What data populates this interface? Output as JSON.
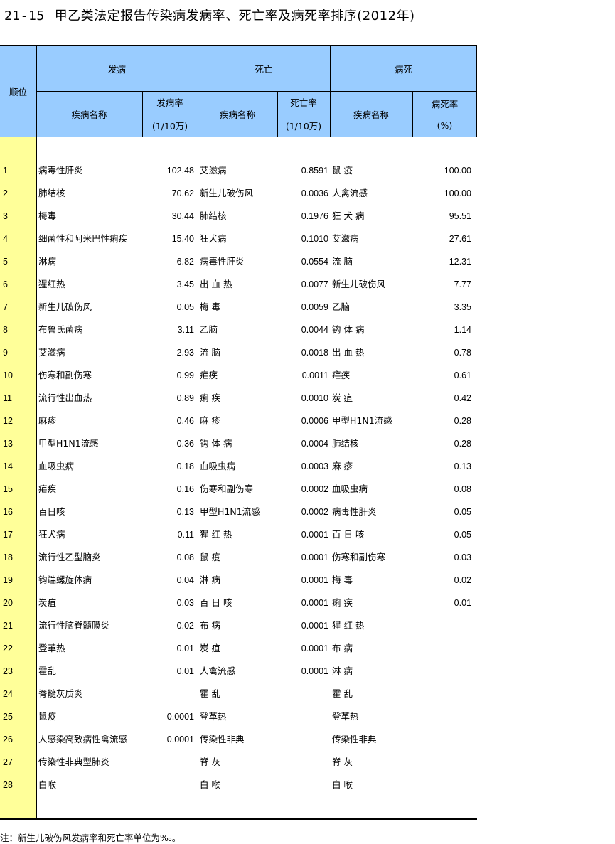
{
  "title": {
    "number": "21-15",
    "text": "甲乙类法定报告传染病发病率、死亡率及病死率排序(2012年)"
  },
  "header": {
    "rank": "顺位",
    "incidence": "发病",
    "death": "死亡",
    "fatality": "病死",
    "disease_name": "疾病名称",
    "incidence_rate_line1": "发病率",
    "incidence_rate_line2": "(1/10万)",
    "death_rate_line1": "死亡率",
    "death_rate_line2": "(1/10万)",
    "fatality_rate_line1": "病死率",
    "fatality_rate_line2": "(%)"
  },
  "rows": [
    {
      "rank": "1",
      "d1": "病毒性肝炎",
      "r1": "102.48",
      "d2": "艾滋病",
      "r2": "0.8591",
      "d3": "鼠 疫",
      "r3": "100.00"
    },
    {
      "rank": "2",
      "d1": "肺结核",
      "r1": "70.62",
      "d2": "新生儿破伤风",
      "r2": "0.0036",
      "d3": "人禽流感",
      "r3": "100.00"
    },
    {
      "rank": "3",
      "d1": "梅毒",
      "r1": "30.44",
      "d2": "肺结核",
      "r2": "0.1976",
      "d3": "狂 犬 病",
      "r3": "95.51"
    },
    {
      "rank": "4",
      "d1": "细菌性和阿米巴性痢疾",
      "r1": "15.40",
      "d2": "狂犬病",
      "r2": "0.1010",
      "d3": "艾滋病",
      "r3": "27.61"
    },
    {
      "rank": "5",
      "d1": "淋病",
      "r1": "6.82",
      "d2": "病毒性肝炎",
      "r2": "0.0554",
      "d3": "流 脑",
      "r3": "12.31"
    },
    {
      "rank": "6",
      "d1": "猩红热",
      "r1": "3.45",
      "d2": "出 血 热",
      "r2": "0.0077",
      "d3": "新生儿破伤风",
      "r3": "7.77"
    },
    {
      "rank": "7",
      "d1": "新生儿破伤风",
      "r1": "0.05",
      "d2": "梅 毒",
      "r2": "0.0059",
      "d3": "乙脑",
      "r3": "3.35"
    },
    {
      "rank": "8",
      "d1": "布鲁氏菌病",
      "r1": "3.11",
      "d2": "乙脑",
      "r2": "0.0044",
      "d3": "钩 体 病",
      "r3": "1.14"
    },
    {
      "rank": "9",
      "d1": "艾滋病",
      "r1": "2.93",
      "d2": "流 脑",
      "r2": "0.0018",
      "d3": "出 血 热",
      "r3": "0.78"
    },
    {
      "rank": "10",
      "d1": "伤寒和副伤寒",
      "r1": "0.99",
      "d2": "疟疾",
      "r2": "0.0011",
      "d3": "疟疾",
      "r3": "0.61"
    },
    {
      "rank": "11",
      "d1": "流行性出血热",
      "r1": "0.89",
      "d2": "痢 疾",
      "r2": "0.0010",
      "d3": "炭 疽",
      "r3": "0.42"
    },
    {
      "rank": "12",
      "d1": "麻疹",
      "r1": "0.46",
      "d2": "麻 疹",
      "r2": "0.0006",
      "d3": "甲型H1N1流感",
      "r3": "0.28"
    },
    {
      "rank": "13",
      "d1": "甲型H1N1流感",
      "r1": "0.36",
      "d2": "钩 体 病",
      "r2": "0.0004",
      "d3": "肺结核",
      "r3": "0.28"
    },
    {
      "rank": "14",
      "d1": "血吸虫病",
      "r1": "0.18",
      "d2": "血吸虫病",
      "r2": "0.0003",
      "d3": "麻 疹",
      "r3": "0.13"
    },
    {
      "rank": "15",
      "d1": "疟疾",
      "r1": "0.16",
      "d2": "伤寒和副伤寒",
      "r2": "0.0002",
      "d3": "血吸虫病",
      "r3": "0.08"
    },
    {
      "rank": "16",
      "d1": "百日咳",
      "r1": "0.13",
      "d2": "甲型H1N1流感",
      "r2": "0.0002",
      "d3": "病毒性肝炎",
      "r3": "0.05"
    },
    {
      "rank": "17",
      "d1": "狂犬病",
      "r1": "0.11",
      "d2": "猩 红 热",
      "r2": "0.0001",
      "d3": "百 日 咳",
      "r3": "0.05"
    },
    {
      "rank": "18",
      "d1": "流行性乙型脑炎",
      "r1": "0.08",
      "d2": "鼠 疫",
      "r2": "0.0001",
      "d3": "伤寒和副伤寒",
      "r3": "0.03"
    },
    {
      "rank": "19",
      "d1": "钩端螺旋体病",
      "r1": "0.04",
      "d2": "淋 病",
      "r2": "0.0001",
      "d3": "梅 毒",
      "r3": "0.02"
    },
    {
      "rank": "20",
      "d1": "炭疽",
      "r1": "0.03",
      "d2": "百 日 咳",
      "r2": "0.0001",
      "d3": "痢 疾",
      "r3": "0.01"
    },
    {
      "rank": "21",
      "d1": "流行性脑脊髓膜炎",
      "r1": "0.02",
      "d2": "布 病",
      "r2": "0.0001",
      "d3": "猩 红 热",
      "r3": ""
    },
    {
      "rank": "22",
      "d1": "登革热",
      "r1": "0.01",
      "d2": "炭 疽",
      "r2": "0.0001",
      "d3": "布 病",
      "r3": ""
    },
    {
      "rank": "23",
      "d1": "霍乱",
      "r1": "0.01",
      "d2": "人禽流感",
      "r2": "0.0001",
      "d3": "淋 病",
      "r3": ""
    },
    {
      "rank": "24",
      "d1": "脊髓灰质炎",
      "r1": "",
      "d2": "霍 乱",
      "r2": "",
      "d3": "霍 乱",
      "r3": ""
    },
    {
      "rank": "25",
      "d1": "鼠疫",
      "r1": "0.0001",
      "d2": "登革热",
      "r2": "",
      "d3": "登革热",
      "r3": ""
    },
    {
      "rank": "26",
      "d1": "人感染高致病性禽流感",
      "r1": "0.0001",
      "d2": "传染性非典",
      "r2": "",
      "d3": "传染性非典",
      "r3": ""
    },
    {
      "rank": "27",
      "d1": "传染性非典型肺炎",
      "r1": "",
      "d2": "脊 灰",
      "r2": "",
      "d3": "脊 灰",
      "r3": ""
    },
    {
      "rank": "28",
      "d1": "白喉",
      "r1": "",
      "d2": "白 喉",
      "r2": "",
      "d3": "白 喉",
      "r3": ""
    }
  ],
  "note": "注：新生儿破伤风发病率和死亡率单位为‰。",
  "colors": {
    "header_bg": "#99ccff",
    "rank_bg": "#ffff99"
  }
}
